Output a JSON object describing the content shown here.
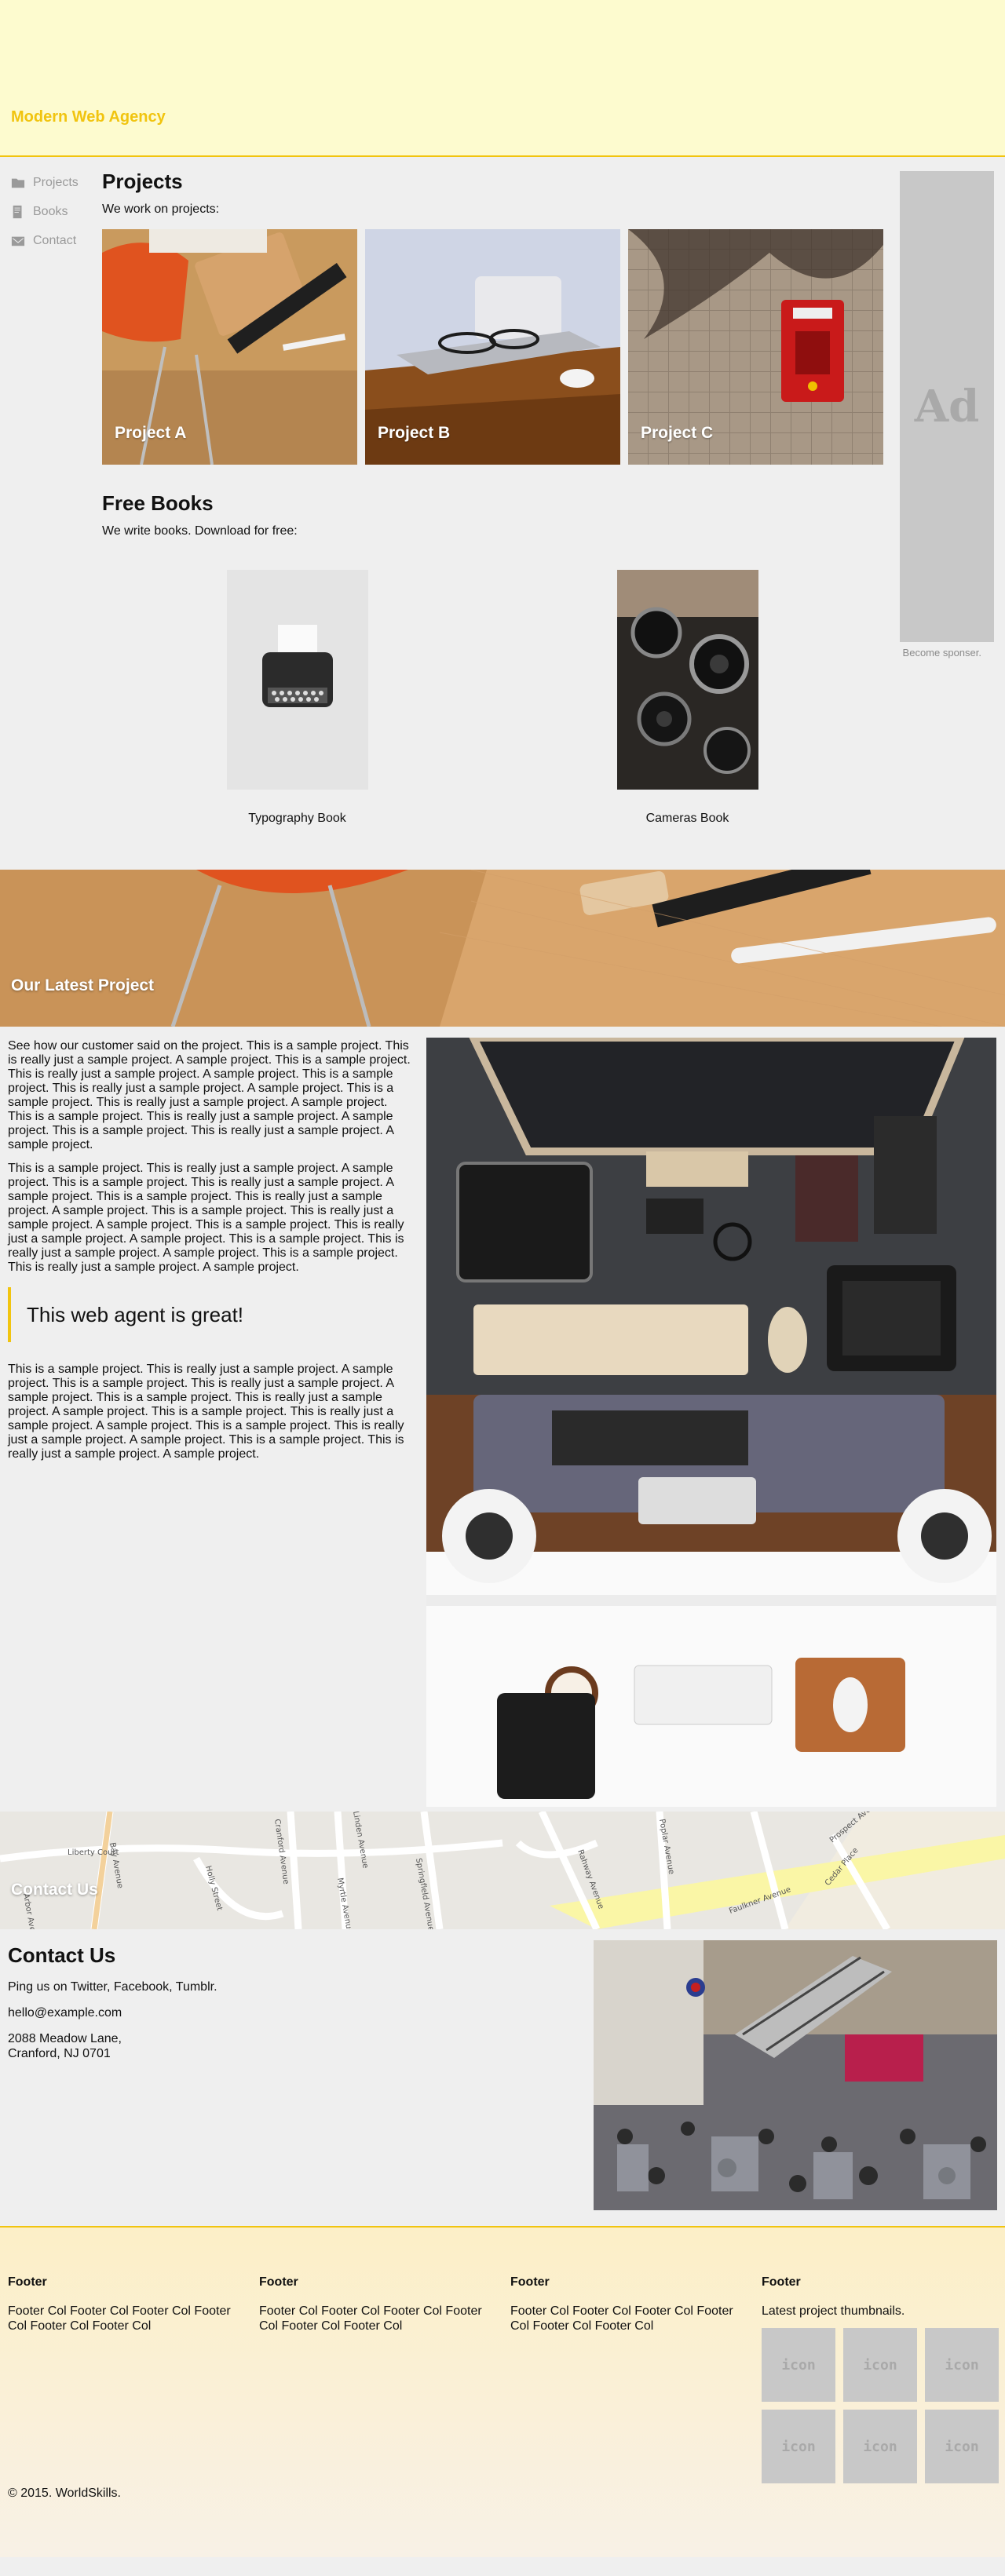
{
  "header": {
    "brand": "Modern Web Agency"
  },
  "sidebar": {
    "items": [
      {
        "label": "Projects",
        "icon": "folder-icon"
      },
      {
        "label": "Books",
        "icon": "book-icon"
      },
      {
        "label": "Contact",
        "icon": "mail-icon"
      }
    ]
  },
  "projects": {
    "title": "Projects",
    "lead": "We work on projects:",
    "items": [
      {
        "label": "Project A"
      },
      {
        "label": "Project B"
      },
      {
        "label": "Project C"
      }
    ]
  },
  "books": {
    "title": "Free Books",
    "lead": "We write books. Download for free:",
    "items": [
      {
        "label": "Typography Book"
      },
      {
        "label": "Cameras Book"
      }
    ]
  },
  "ad": {
    "text": "Ad",
    "caption": "Become sponser."
  },
  "latest": {
    "title": "Our Latest Project",
    "p1": "See how our customer said on the project. This is a sample project. This is really just a sample project. A sample project. This is a sample project. This is really just a sample project. A sample project. This is a sample project. This is really just a sample project. A sample project. This is a sample project. This is really just a sample project. A sample project. This is a sample project. This is really just a sample project. A sample project. This is a sample project. This is really just a sample project. A sample project.",
    "p2": "This is a sample project. This is really just a sample project. A sample project. This is a sample project. This is really just a sample project. A sample project. This is a sample project. This is really just a sample project. A sample project. This is a sample project. This is really just a sample project. A sample project. This is a sample project. This is really just a sample project. A sample project. This is a sample project. This is really just a sample project. A sample project. This is a sample project. This is really just a sample project. A sample project.",
    "quote": "This web agent is great!",
    "p3": "This is a sample project. This is really just a sample project. A sample project. This is a sample project. This is really just a sample project. A sample project. This is a sample project. This is really just a sample project. A sample project. This is a sample project. This is really just a sample project. A sample project. This is a sample project. This is really just a sample project. A sample project. This is a sample project. This is really just a sample project. A sample project."
  },
  "map": {
    "title": "Contact Us",
    "streets": [
      "Liberty Court",
      "Bay Avenue",
      "Holly Street",
      "Cranford Avenue",
      "Rahway Avenue",
      "Myrtle Avenue",
      "Poplar Avenue",
      "Springfield Avenue",
      "Prospect Avenue",
      "Linden Avenue",
      "Arbor Avenue",
      "Faulkner Avenue",
      "Cedar Place"
    ]
  },
  "contact": {
    "title": "Contact Us",
    "social": "Ping us on Twitter, Facebook, Tumblr.",
    "email": "hello@example.com",
    "address1": "2088 Meadow Lane,",
    "address2": "Cranford, NJ 0701"
  },
  "footer": {
    "cols": [
      {
        "title": "Footer",
        "text": "Footer Col Footer Col Footer Col Footer Col Footer Col Footer Col"
      },
      {
        "title": "Footer",
        "text": "Footer Col Footer Col Footer Col Footer Col Footer Col Footer Col"
      },
      {
        "title": "Footer",
        "text": "Footer Col Footer Col Footer Col Footer Col Footer Col Footer Col"
      }
    ],
    "thumbs_title": "Footer",
    "thumbs_lead": "Latest project thumbnails.",
    "thumb_label": "icon",
    "copyright": "© 2015. WorldSkills."
  },
  "colors": {
    "accent": "#f1c40f",
    "header_bg": "#fdfbcf",
    "page_bg": "#efefef"
  }
}
